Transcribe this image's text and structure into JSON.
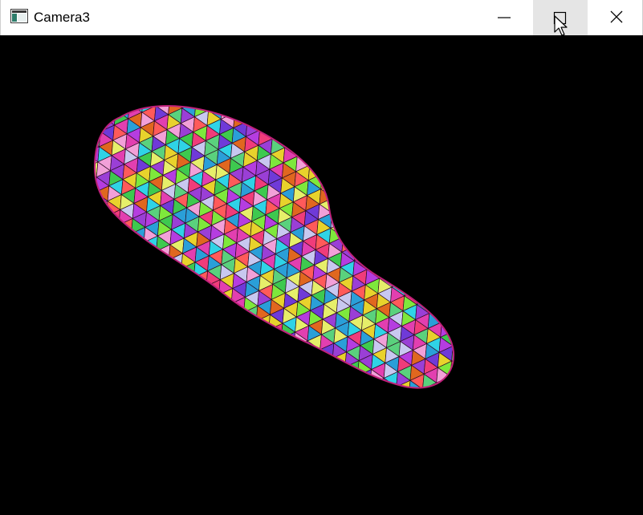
{
  "window": {
    "title": "Camera3"
  },
  "caption_buttons": {
    "minimize_icon": "minimize-icon",
    "maximize_icon": "maximize-icon",
    "close_icon": "close-icon",
    "hovered": "maximize"
  },
  "viewport": {
    "background": "#000000",
    "object": "triangulated-mesh",
    "palette": [
      "#e23fb0",
      "#9a3fd6",
      "#2fd3e6",
      "#e8d22c",
      "#3ec94f",
      "#e0671f",
      "#f03c7a",
      "#b53de0",
      "#5ad17d",
      "#f2a0d8",
      "#6f3ad8",
      "#e6ef6a",
      "#2a9fd8",
      "#ff5a5a",
      "#c8c8f0",
      "#7ee83c"
    ]
  }
}
